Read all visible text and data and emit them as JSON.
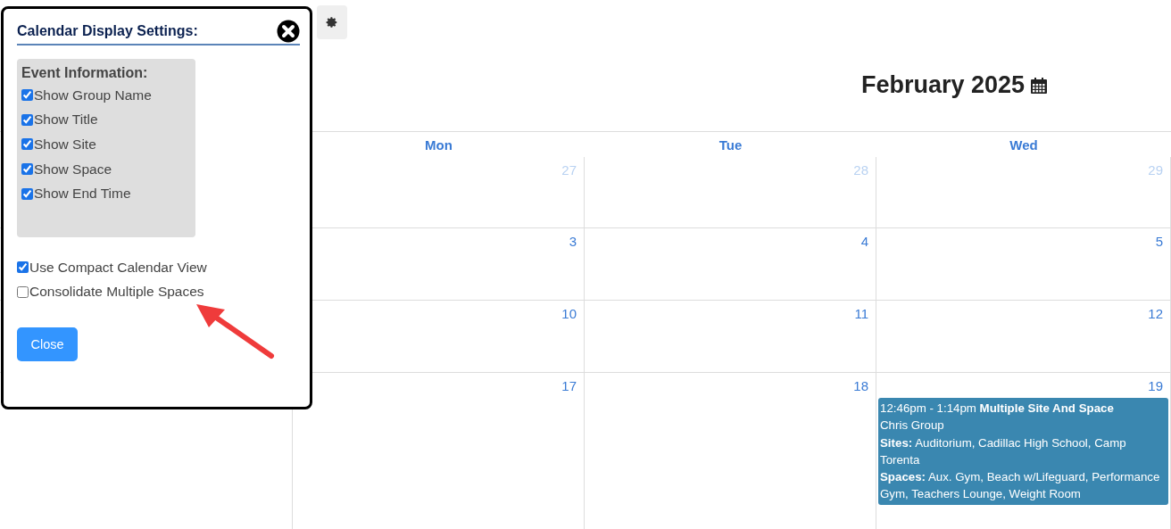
{
  "calendar": {
    "title": "February 2025",
    "weekdays": [
      {
        "label": "Mon"
      },
      {
        "label": "Tue"
      },
      {
        "label": "Wed"
      }
    ],
    "weeks": [
      {
        "days": [
          {
            "number": "27",
            "outside": true
          },
          {
            "number": "28",
            "outside": true
          },
          {
            "number": "29",
            "outside": true
          }
        ]
      },
      {
        "days": [
          {
            "number": "3",
            "outside": false
          },
          {
            "number": "4",
            "outside": false
          },
          {
            "number": "5",
            "outside": false
          }
        ]
      },
      {
        "days": [
          {
            "number": "10",
            "outside": false
          },
          {
            "number": "11",
            "outside": false
          },
          {
            "number": "12",
            "outside": false
          }
        ]
      },
      {
        "days": [
          {
            "number": "17",
            "outside": false
          },
          {
            "number": "18",
            "outside": false
          },
          {
            "number": "19",
            "outside": false,
            "events": [
              {
                "lines": [
                  "12:46pm - 1:14pm **Multiple Site And Space**",
                  "Chris Group",
                  "**Sites:** Auditorium, Cadillac High School, Camp Torenta",
                  "**Spaces:** Aux. Gym, Beach w/Lifeguard, Performance Gym, Teachers Lounge, Weight Room"
                ]
              }
            ]
          }
        ]
      }
    ]
  },
  "settings_dialog": {
    "title": "Calendar Display Settings:",
    "section_title": "Event Information:",
    "event_options": [
      {
        "label": "Show Group Name",
        "checked": true
      },
      {
        "label": "Show Title",
        "checked": true
      },
      {
        "label": "Show Site",
        "checked": true
      },
      {
        "label": "Show Space",
        "checked": true
      },
      {
        "label": "Show End Time",
        "checked": true
      }
    ],
    "view_options": [
      {
        "label": "Use Compact Calendar View",
        "checked": true
      },
      {
        "label": "Consolidate Multiple Spaces",
        "checked": false
      }
    ],
    "close_button": "Close"
  }
}
